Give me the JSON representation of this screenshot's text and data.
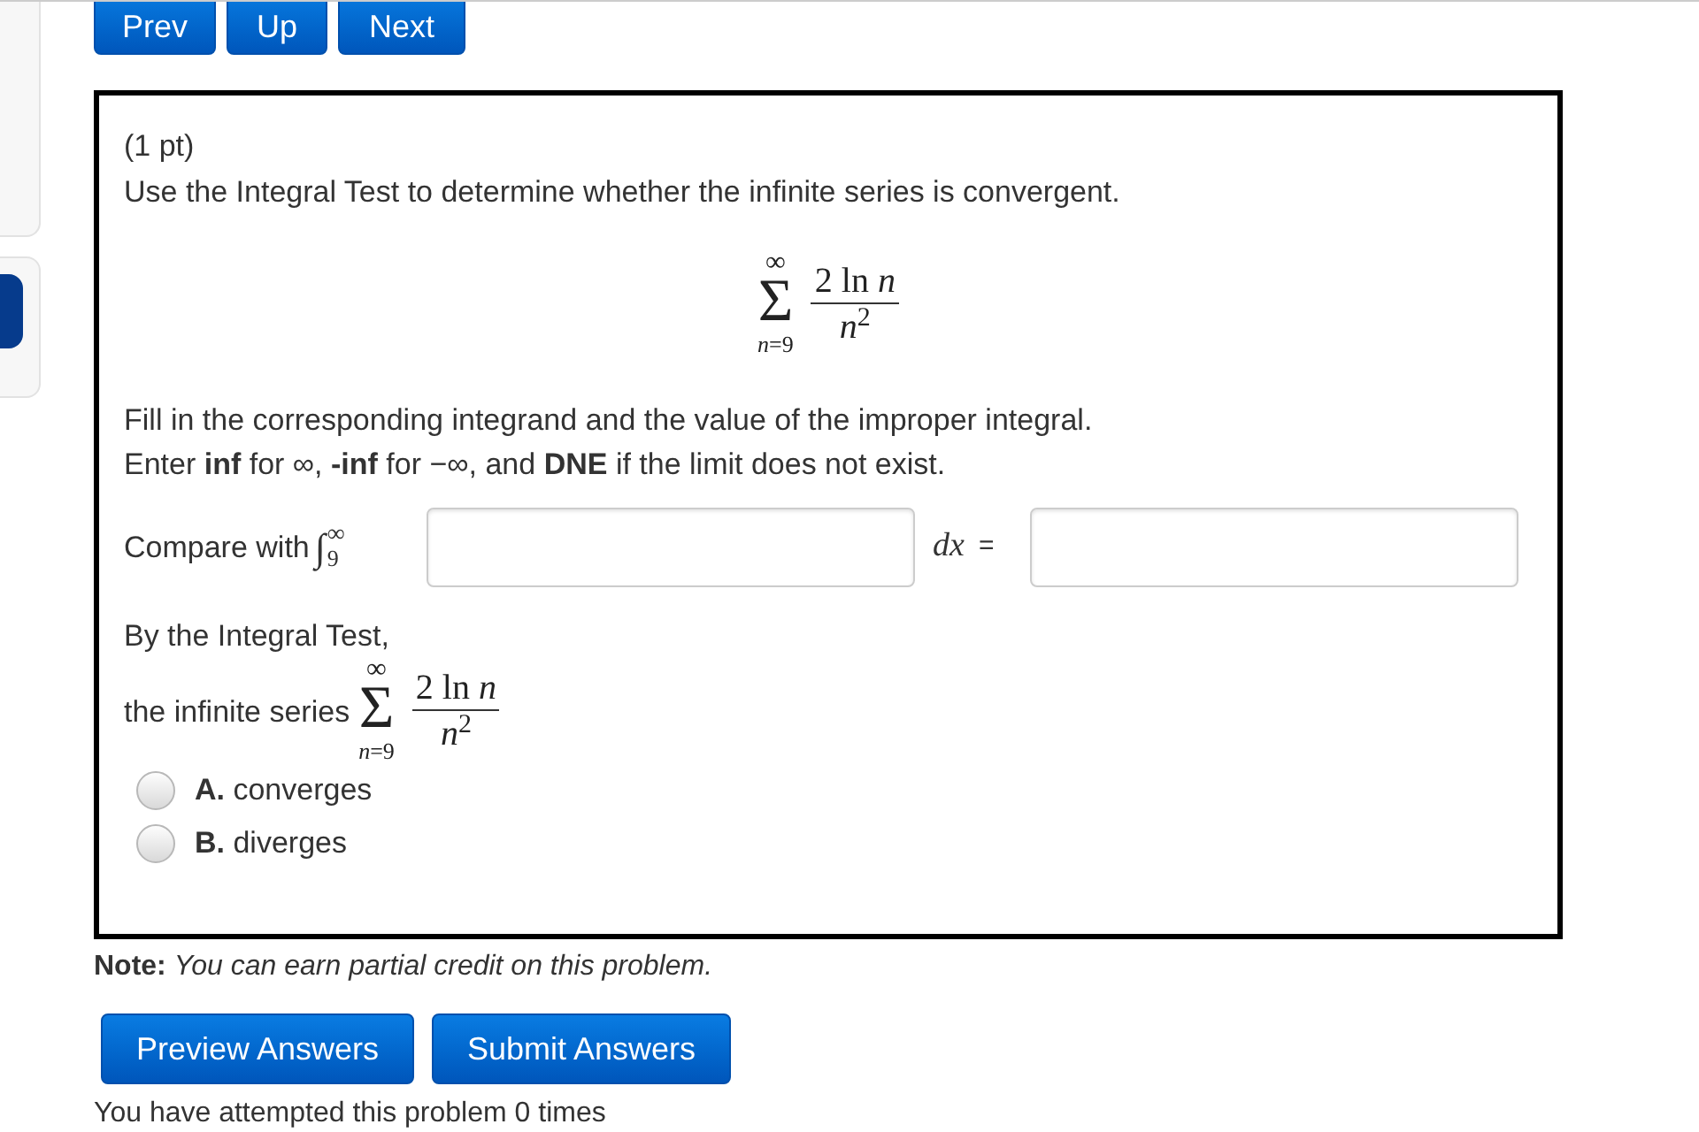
{
  "nav_buttons": [
    {
      "label": "Prev"
    },
    {
      "label": "Up"
    },
    {
      "label": "Next"
    }
  ],
  "problem": {
    "points": "(1 pt)",
    "instruction": "Use the Integral Test to determine whether the infinite series is convergent.",
    "series": {
      "upper": "∞",
      "symbol": "Σ",
      "lower": "*n*=9",
      "numerator": "2 ln *n*",
      "denominator": "*n*$^{2}$"
    },
    "fill_in_text": "Fill in the corresponding integrand and the value of the improper integral.",
    "enter_text": "Enter **inf** for ∞, **-inf** for −∞, and **DNE** if the limit does not exist.",
    "compare": {
      "label": "Compare with",
      "integral": {
        "symbol": "∫",
        "lower": "9",
        "upper": "∞"
      },
      "differential": "dx",
      "equals": "="
    },
    "conclusion_intro": "By the Integral Test,",
    "conclusion": {
      "label": "the infinite series",
      "series": {
        "upper": "∞",
        "symbol": "Σ",
        "lower": "*n*=9",
        "numerator": "2 ln *n*",
        "denominator": "*n*$^{2}$"
      }
    },
    "options": [
      {
        "label": "**A.** converges",
        "selected": false
      },
      {
        "label": "**B.** diverges",
        "selected": false
      }
    ]
  },
  "note": "**Note:** *You can earn partial credit on this problem.*",
  "action_buttons": [
    {
      "label": "Preview Answers"
    },
    {
      "label": "Submit Answers"
    }
  ],
  "attempts_text": "You have attempted this problem 0 times"
}
